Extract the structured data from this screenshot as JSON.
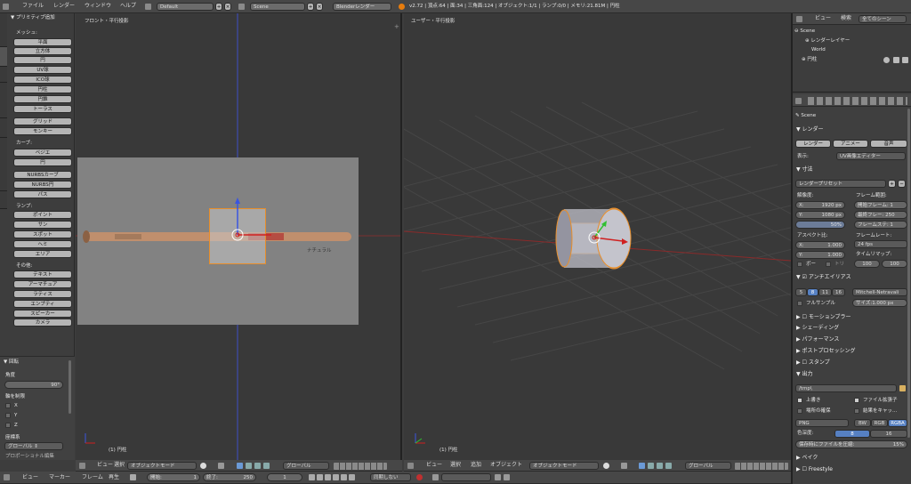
{
  "top": {
    "menus": [
      "ファイル",
      "レンダー",
      "ウィンドウ",
      "ヘルプ"
    ],
    "layout": "Default",
    "scene": "Scene",
    "engine": "Blenderレンダー",
    "stats": "v2.72 | 頂点:64 | 面:34 | 三角面:124 | オブジェクト:1/1 | ランプ:0/0 | メモリ:21.81M | 円柱"
  },
  "left": {
    "vtabs": [
      "ツール",
      "作成",
      "関係",
      "アニメーション",
      "物理演算",
      "グリースペンシル",
      "UV"
    ],
    "title": "プリミティブ追加",
    "mesh_h": "メッシュ:",
    "mesh": [
      "平面",
      "立方体",
      "円",
      "UV球",
      "ICO球",
      "円柱",
      "円錐",
      "トーラス"
    ],
    "mesh2": [
      "グリッド",
      "モンキー"
    ],
    "curve_h": "カーブ:",
    "curve": [
      "ベジエ",
      "円",
      "NURBSカーブ",
      "NURBS円",
      "パス"
    ],
    "lamp_h": "ランプ:",
    "lamp": [
      "ポイント",
      "サン",
      "スポット",
      "ヘミ",
      "エリア"
    ],
    "other_h": "その他:",
    "other": [
      "テキスト",
      "アーマチュア",
      "ラティス",
      "エンプティ",
      "スピーカー",
      "カメラ"
    ],
    "op_title": "回転",
    "angle_l": "角度",
    "angle": "90°",
    "axis_l": "軸を制限",
    "axes": [
      "X",
      "Y",
      "Z"
    ],
    "coord_l": "座標系",
    "coord": "グローバル",
    "extra": "プロポーショナル編集"
  },
  "vp1": {
    "title": "フロント・平行投影",
    "obj": "(1) 円柱",
    "ref_text": "ナチュラル"
  },
  "vp2": {
    "title": "ユーザー・平行投影",
    "obj": "(1) 円柱"
  },
  "vphdr": {
    "view": "ビュー",
    "select": "選択",
    "add": "追加",
    "object": "オブジェクト",
    "mode": "オブジェクトモード",
    "orient": "グローバル"
  },
  "timeline": {
    "view": "ビュー",
    "marker": "マーカー",
    "frame": "フレーム",
    "play": "再生",
    "start": "開始:",
    "start_v": "1",
    "end": "終了:",
    "end_v": "250",
    "cur": "1",
    "sync": "同期しない"
  },
  "outliner": {
    "view": "ビュー",
    "search": "検索",
    "filter": "全てのシーン",
    "items": [
      "Scene",
      "レンダーレイヤー",
      "World",
      "円柱"
    ]
  },
  "props": {
    "scene": "Scene",
    "render_h": "レンダー",
    "render_btn": "レンダー",
    "anim_btn": "アニメー",
    "audio_btn": "音声",
    "display_l": "表示:",
    "display": "UV画像エディター",
    "dim_h": "寸法",
    "preset": "レンダープリセット",
    "res_l": "解像度:",
    "resx_l": "X:",
    "resx": "1920 px",
    "resy_l": "Y:",
    "resy": "1080 px",
    "pct": "50%",
    "frange_l": "フレーム範囲:",
    "fstart": "開始フレーム: 1",
    "fend": "最終フレー: 250",
    "fstep": "フレームステ: 1",
    "asp_l": "アスペクト比:",
    "aspx_l": "X:",
    "aspx": "1.000",
    "aspy_l": "Y:",
    "aspy": "1.000",
    "fps_l": "フレームレート:",
    "fps": "24 fps",
    "remap_l": "タイムリマップ:",
    "remap_a": "100",
    "remap_b": "100",
    "border": "ボー",
    "crop": "トリ",
    "aa_h": "アンチエイリアス",
    "aa_vals": [
      "5",
      "8",
      "11",
      "16"
    ],
    "aa_filter": "Mitchell-Netravali",
    "full": "フルサンプル",
    "size": "サイズ:1.000 px",
    "collapsed": [
      "モーションブラー",
      "シェーディング",
      "パフォーマンス",
      "ポストプロセッシング",
      "スタンプ"
    ],
    "out_h": "出力",
    "path": "/tmp\\",
    "overwrite": "上書き",
    "ext": "ファイル拡張子",
    "placeholder": "場所の確保",
    "cache": "結果をキャッ...",
    "format": "PNG",
    "bw": "BW",
    "rgb": "RGB",
    "rgba": "RGBA",
    "depth_l": "色深度:",
    "depth8": "8",
    "depth16": "16",
    "comp": "保存時にファイルを圧縮:",
    "comp_v": "15%",
    "bake_h": "ベイク",
    "freestyle_h": "Freestyle"
  }
}
